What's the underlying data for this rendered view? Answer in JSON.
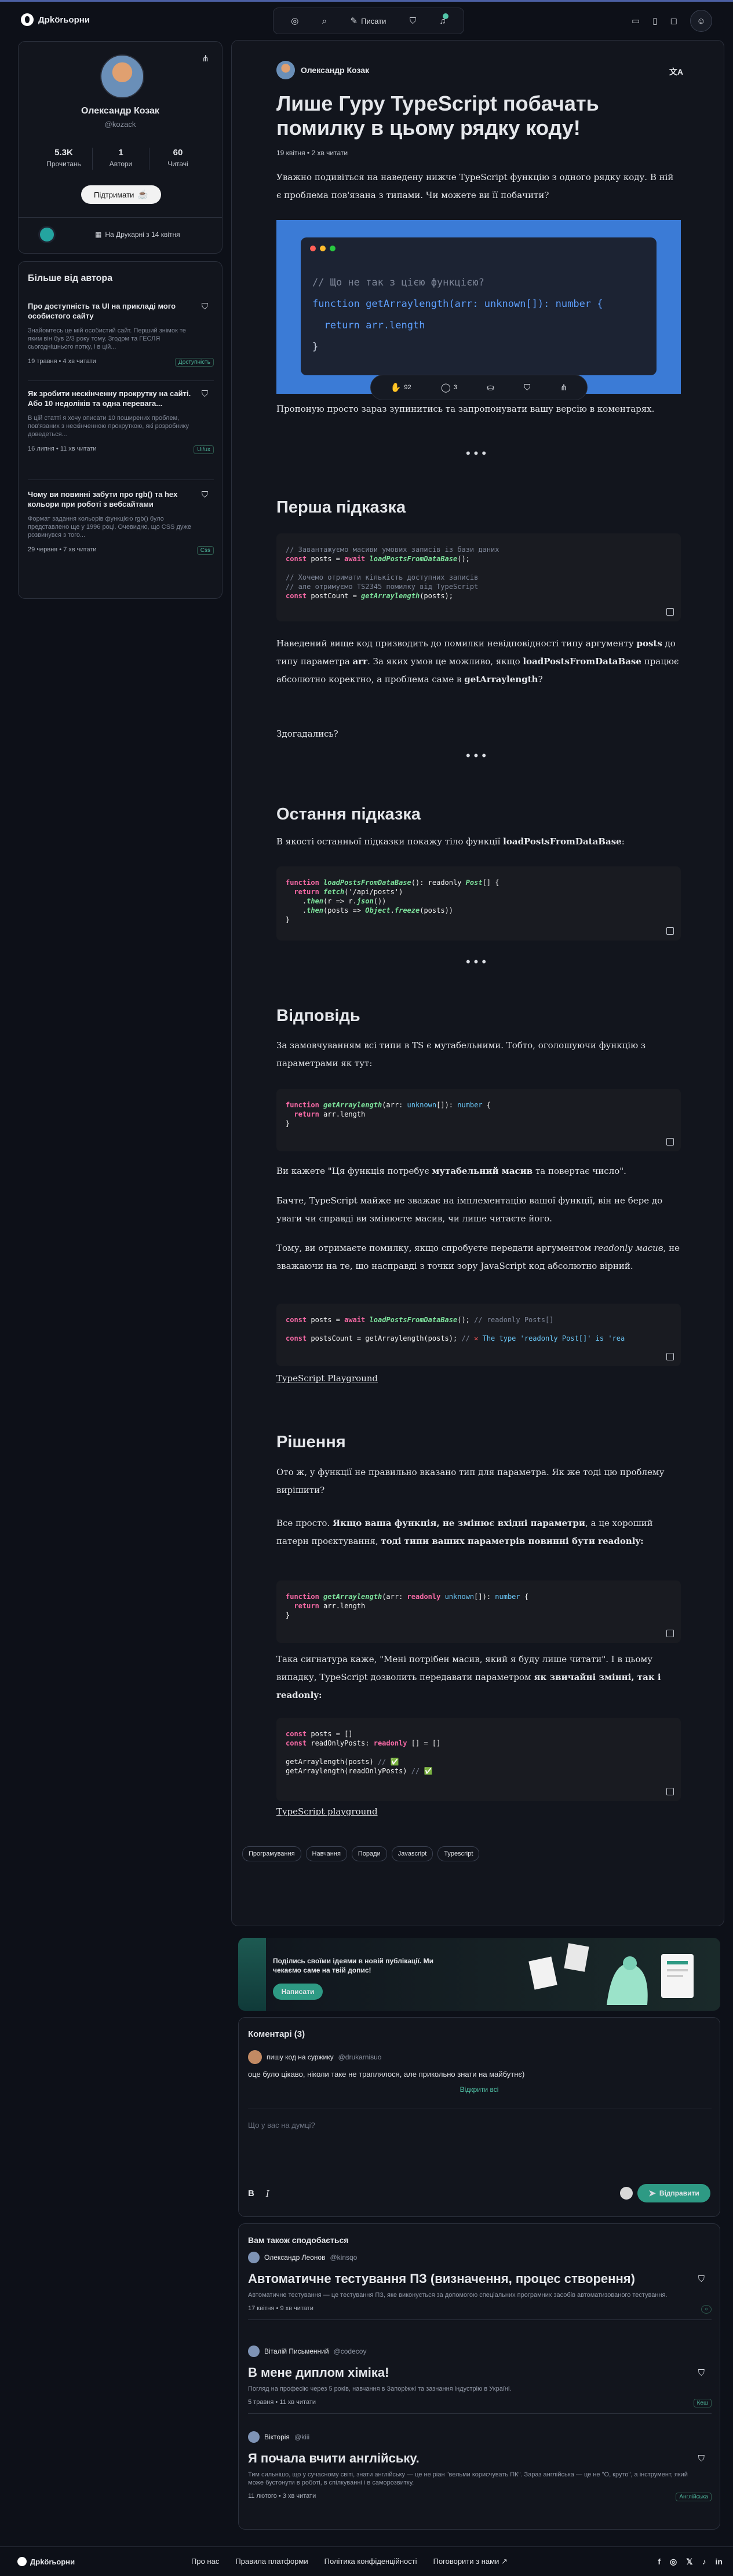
{
  "app": {
    "name": "Дрkörьoрни"
  },
  "topbar": {
    "publish_label": "Писати",
    "icons": [
      "compass-icon",
      "search-icon",
      "pen-icon",
      "bookmark-icon",
      "bell-icon",
      "monitor-icon",
      "tablet-icon",
      "user-icon"
    ]
  },
  "author": {
    "name": "Олександр Козак",
    "handle": "@kozack",
    "stats": [
      {
        "value": "5.3K",
        "label": "Прочитань"
      },
      {
        "value": "1",
        "label": "Автори"
      },
      {
        "value": "60",
        "label": "Читачі"
      }
    ],
    "support_label": "Підтримати",
    "since": "На Друкарні з 14 квітня"
  },
  "more_by_author": {
    "title": "Більше від автора",
    "items": [
      {
        "title": "Про доступність та UI на прикладі мого особистого сайту",
        "desc": "Знайомтесь це мій особистий сайт. Перший знімок те яким він був 2/3 року тому. Згодом та ГЕСЛЯ сьогоднішнього потку, і в цій...",
        "date": "19 травня",
        "read": "4 хв читати",
        "tag": "Доступність"
      },
      {
        "title": "Як зробити нескінченну прокрутку на сайті. Або 10 недоліків та одна перевага...",
        "desc": "В цій статті я хочу описати 10 поширених проблем, пов'язаних з нескінченною прокруткою, які розробнику доведеться...",
        "date": "16 липня",
        "read": "11 хв читати",
        "tag": "Ui/ux"
      },
      {
        "title": "Чому ви повинні забути про rgb() та hex кольори при роботі з вебсайтами",
        "desc": "Формат задання кольорів функцією rgb() було представлено ще у 1996 році. Очевидно, що CSS дуже розвинувся з того...",
        "date": "29 червня",
        "read": "7 хв читати",
        "tag": "Css"
      }
    ]
  },
  "article": {
    "author": "Олександр Козак",
    "translate_label": "文A",
    "title": "Лише Гуру TypeScript побачать помилку в цьому рядку коду!",
    "meta": "19 квітня • 2 хв читати",
    "intro": "Уважно подивіться на наведену нижче TypeScript функцію з одного рядку коду. В ній є проблема пов'язана з типами. Чи можете ви її побачити?",
    "hero_code": [
      "// Що не так з цією функцією?",
      "function getArraylength(arr: unknown[]): number {",
      "  return arr.length",
      "}"
    ],
    "reactions": {
      "likes": "92",
      "comments": "3"
    },
    "suggest": "Пропоную просто зараз зупинитись та запропонувати вашу версію в коментарях.",
    "h_first": "Перша підказка",
    "h_last": "Остання підказка",
    "h_answer": "Відповідь",
    "h_solution": "Рішення",
    "first_hint_text": "Наведений вище код призводить до помилки невідповідності типу аргументу posts до типу параметра arr. За яких умов це можливо, якщо loadPostsFromDataBase працює абсолютно коректно, а проблема саме в getArraylength?",
    "guessed": "Здогадались?",
    "last_hint_intro": "В якості останньої підказки покажу тіло функції loadPostsFromDataBase:",
    "answer_intro": "За замовчуванням всі типи в TS є мутабельними. Тобто, оголошуючи функцію з параметрами як тут:",
    "answer_p2": "Ви кажете \"Ця функція потребує мутабельний масив та повертає число\".",
    "answer_p3": "Бачте, TypeScript майже не зважає на імплементацію вашої функції, він не бере до уваги чи справді ви змінюєте масив, чи лише читаєте його.",
    "answer_p4": "Тому, ви отримаєте помилку, якщо спробуєте передати аргументом readonly масив, не зважаючи на те, що насправді з точки зору JavaScript код абсолютно вірний.",
    "playground1": "TypeScript Playground",
    "solution_p1": "Ото ж, у функції не правильно вказано тип для параметра. Як же тоді цю проблему вирішити?",
    "solution_p2": "Все просто. Якщо ваша функція, не змінює вхідні параметри, а це хороший патерн проєктування, тоді типи ваших параметрів повинні бути readonly:",
    "solution_p3": "Така сигнатура каже, \"Мені потрібен масив, який я буду лише читати\". І в цьому випадку, TypeScript дозволить передавати параметром як звичайні змінні, так і readonly:",
    "playground2": "TypeScript playground",
    "tags": [
      "Програмування",
      "Навчання",
      "Поради",
      "Javascript",
      "Typescript"
    ]
  },
  "promo": {
    "text": "Поділись своїми ідеями в новій публікації. Ми чекаємо саме на твій допис!",
    "button": "Написати"
  },
  "comments": {
    "title": "Коментарі (3)",
    "user": "пишу код на суржику",
    "handle": "@drukarnisuo",
    "text": "оце було цікаво, ніколи таке не траплялося, але прикольно знати на майбутнє)",
    "show_all": "Відкрити всі",
    "placeholder": "Що у вас на думці?",
    "send": "Відправити"
  },
  "related": {
    "title": "Вам також сподобається",
    "items": [
      {
        "user": "Олександр Леонов",
        "handle": "@kinsqo",
        "title": "Автоматичне тестування ПЗ (визначення, процес створення)",
        "desc": "Автоматичне тестування — це тестування ПЗ, яке виконується за допомогою спеціальних програмних засобів автоматизованого тестування.",
        "date": "17 квітня",
        "read": "9 хв читати",
        "tag": ""
      },
      {
        "user": "Віталій Письменний",
        "handle": "@codecoy",
        "title": "В мене диплом хіміка!",
        "desc": "Погляд на професію через 5 років, навчання в Запоріжжі та зазнання індустрію в Україні.",
        "date": "5 травня",
        "read": "11 хв читати",
        "tag": "Кеш"
      },
      {
        "user": "Вікторія",
        "handle": "@kiii",
        "title": "Я почала вчити англійську.",
        "desc": "Тим сильнішо, що у сучасному світі, знати англійську — це не ріан \"вельми корисчувать ПК\". Зараз англійська — це не \"О, круто\", а інструмент, який може бустонути в роботі, в спілкуванні і в саморозвитку.",
        "date": "11 лютого",
        "read": "3 хв читати",
        "tag": "Англійська"
      }
    ]
  },
  "footer": {
    "links": [
      "Про нас",
      "Правила платформи",
      "Політика конфіденційності",
      "Поговорити з нами ↗"
    ],
    "social": [
      "f",
      "◎",
      "𝕏",
      "♪",
      "in"
    ]
  },
  "colors": {
    "accent": "#2e9a84",
    "background": "#0d1018",
    "card": "#12151d",
    "hero": "#3b7bd6"
  }
}
